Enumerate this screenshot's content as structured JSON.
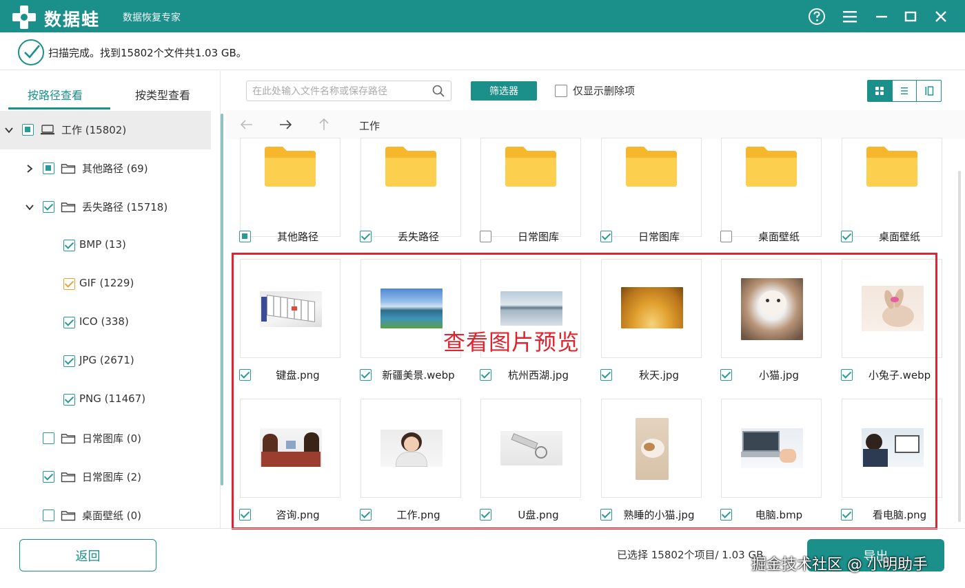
{
  "app": {
    "name": "数据蛙",
    "subtitle": "数据恢复专家"
  },
  "status": {
    "text": "扫描完成。找到15802个文件共1.03 GB。"
  },
  "sidebar": {
    "tabs": [
      {
        "label": "按路径查看",
        "active": true
      },
      {
        "label": "按类型查看",
        "active": false
      }
    ],
    "tree": [
      {
        "label": "工作 (15802)",
        "state": "partial",
        "icon": "drive-icon",
        "expander": "expanded",
        "selected": true
      },
      {
        "label": "其他路径 (69)",
        "state": "partial",
        "icon": "folder-icon",
        "expander": "collapsed"
      },
      {
        "label": "丢失路径 (15718)",
        "state": "checked",
        "icon": "folder-icon",
        "expander": "expanded"
      },
      {
        "label": "BMP (13)",
        "state": "checked"
      },
      {
        "label": "GIF (1229)",
        "state": "checked",
        "highlight": true
      },
      {
        "label": "ICO (338)",
        "state": "checked"
      },
      {
        "label": "JPG (2671)",
        "state": "checked"
      },
      {
        "label": "PNG (11467)",
        "state": "checked"
      },
      {
        "label": "日常图库 (0)",
        "state": "empty",
        "icon": "folder-icon"
      },
      {
        "label": "日常图库 (2)",
        "state": "checked",
        "icon": "folder-icon"
      },
      {
        "label": "桌面壁纸 (0)",
        "state": "empty",
        "icon": "folder-icon"
      }
    ]
  },
  "toolbar": {
    "search_placeholder": "在此处输入文件名称或保存路径",
    "filter_label": "筛选器",
    "deleted_only_label": "仅显示删除项",
    "view_modes": [
      "grid-view-icon",
      "list-view-icon",
      "detail-view-icon"
    ]
  },
  "nav": {
    "path": "工作"
  },
  "folders": [
    {
      "name": "其他路径",
      "state": "partial"
    },
    {
      "name": "丢失路径",
      "state": "checked"
    },
    {
      "name": "日常图库",
      "state": "empty"
    },
    {
      "name": "日常图库",
      "state": "checked"
    },
    {
      "name": "桌面壁纸",
      "state": "empty"
    },
    {
      "name": "桌面壁纸",
      "state": "checked"
    }
  ],
  "images_row1": [
    {
      "name": "键盘.png",
      "state": "checked",
      "thumb": "keyboard"
    },
    {
      "name": "新疆美景.webp",
      "state": "checked",
      "thumb": "lake-mountains"
    },
    {
      "name": "杭州西湖.jpg",
      "state": "checked",
      "thumb": "west-lake"
    },
    {
      "name": "秋天.jpg",
      "state": "checked",
      "thumb": "autumn"
    },
    {
      "name": "小猫.jpg",
      "state": "checked",
      "thumb": "kitten"
    },
    {
      "name": "小兔子.webp",
      "state": "checked",
      "thumb": "rabbit"
    }
  ],
  "images_row2": [
    {
      "name": "咨询.png",
      "state": "checked",
      "thumb": "consult"
    },
    {
      "name": "工作.png",
      "state": "checked",
      "thumb": "headset"
    },
    {
      "name": "U盘.png",
      "state": "checked",
      "thumb": "usb"
    },
    {
      "name": "熟睡的小猫.jpg",
      "state": "checked",
      "thumb": "sleeping-cat"
    },
    {
      "name": "电脑.bmp",
      "state": "checked",
      "thumb": "laptop"
    },
    {
      "name": "看电脑.png",
      "state": "checked",
      "thumb": "man-computer"
    }
  ],
  "annotation": "查看图片预览",
  "footer": {
    "back_label": "返回",
    "selection_info": "已选择 15802个项目/ 1.03 GB",
    "export_label": "导出"
  },
  "watermark": "掘金技术社区 @ 小明助手",
  "colors": {
    "brand": "#1b8f8a",
    "annotation_red": "#e0232e",
    "folder_yellow": "#fcc83a"
  }
}
